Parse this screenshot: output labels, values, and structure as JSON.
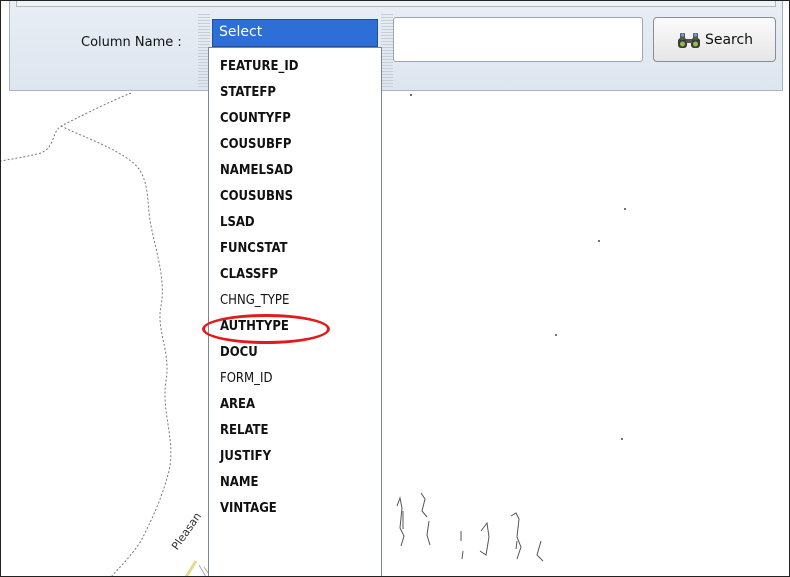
{
  "filter": {
    "column_label": "Column Name :",
    "selected": "Select",
    "search_value": "",
    "search_button_label": "Search"
  },
  "dropdown": {
    "options": [
      "FEATURE_ID",
      "STATEFP",
      "COUNTYFP",
      "COUSUBFP",
      "NAMELSAD",
      "COUSUBNS",
      "LSAD",
      "FUNCSTAT",
      "CLASSFP",
      "CHNG_TYPE",
      "AUTHTYPE",
      "DOCU",
      "FORM_ID",
      "AREA",
      "RELATE",
      "JUSTIFY",
      "NAME",
      "VINTAGE"
    ],
    "highlighted_option": "CHNG_TYPE"
  },
  "map": {
    "road_label": "Pleasan"
  },
  "colors": {
    "selection_blue": "#2d6fd6",
    "highlight_red": "#e21a1a"
  },
  "icons": {
    "search_button": "binoculars-icon"
  }
}
